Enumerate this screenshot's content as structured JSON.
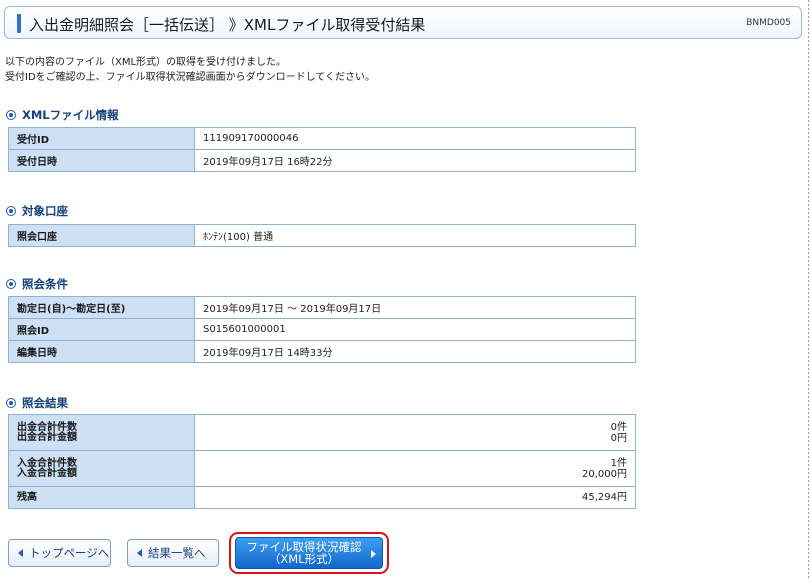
{
  "header": {
    "title": "入出金明細照会［一括伝送］ 》XMLファイル取得受付結果",
    "screen_id": "BNMD005"
  },
  "intro": {
    "line1": "以下の内容のファイル（XML形式）の取得を受け付けました。",
    "line2": "受付IDをご確認の上、ファイル取得状況確認画面からダウンロードしてください。"
  },
  "xml_info": {
    "heading": "XMLファイル情報",
    "rows": [
      {
        "label": "受付ID",
        "value": "111909170000046"
      },
      {
        "label": "受付日時",
        "value": "2019年09月17日 16時22分"
      }
    ]
  },
  "account": {
    "heading": "対象口座",
    "rows": [
      {
        "label": "照会口座",
        "value": "ﾎﾝﾃﾝ(100) 普通"
      }
    ]
  },
  "conditions": {
    "heading": "照会条件",
    "rows": [
      {
        "label": "勘定日(自)～勘定日(至)",
        "value": "2019年09月17日 ～ 2019年09月17日"
      },
      {
        "label": "照会ID",
        "value": "S015601000001"
      },
      {
        "label": "編集日時",
        "value": "2019年09月17日 14時33分"
      }
    ]
  },
  "results": {
    "heading": "照会結果",
    "rows": [
      {
        "label1": "出金合計件数",
        "label2": "出金合計金額",
        "value1": "0件",
        "value2": "0円"
      },
      {
        "label1": "入金合計件数",
        "label2": "入金合計金額",
        "value1": "1件",
        "value2": "20,000円"
      }
    ],
    "balance_label": "残高",
    "balance_value": "45,294円"
  },
  "buttons": {
    "top": "トップページへ",
    "list": "結果一覧へ",
    "confirm_line1": "ファイル取得状況確認",
    "confirm_line2": "（XML形式）"
  }
}
